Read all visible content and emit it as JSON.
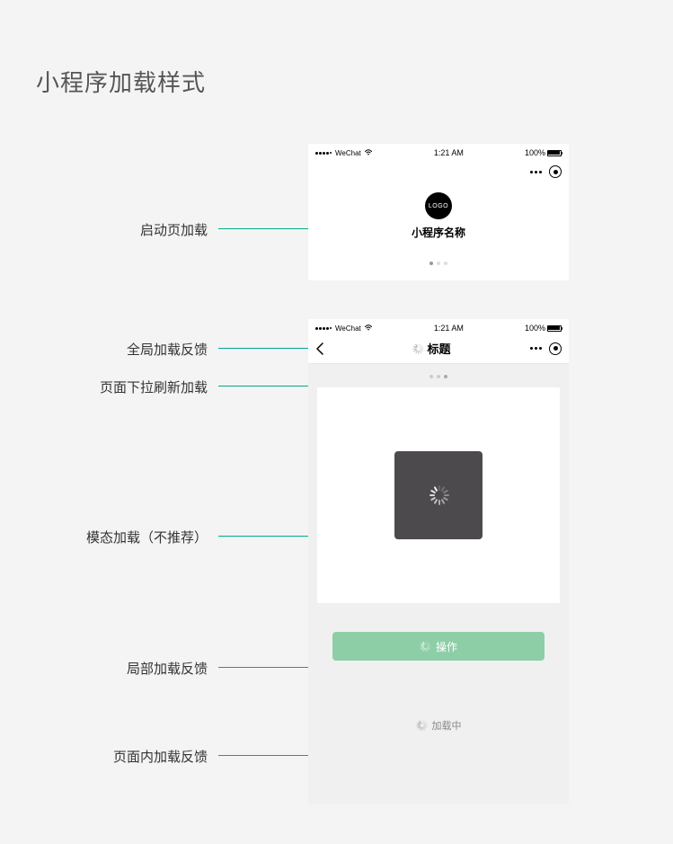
{
  "title": "小程序加载样式",
  "labels": {
    "launch": "启动页加载",
    "global": "全局加载反馈",
    "pull": "页面下拉刷新加载",
    "modal": "模态加载（不推荐）",
    "local": "局部加载反馈",
    "inline": "页面内加载反馈"
  },
  "statusbar": {
    "carrier": "WeChat",
    "time": "1:21 AM",
    "battery": "100%"
  },
  "phone1": {
    "logo": "LOGO",
    "appName": "小程序名称"
  },
  "phone2": {
    "title": "标题",
    "actionButton": "操作",
    "inlineText": "加载中"
  }
}
